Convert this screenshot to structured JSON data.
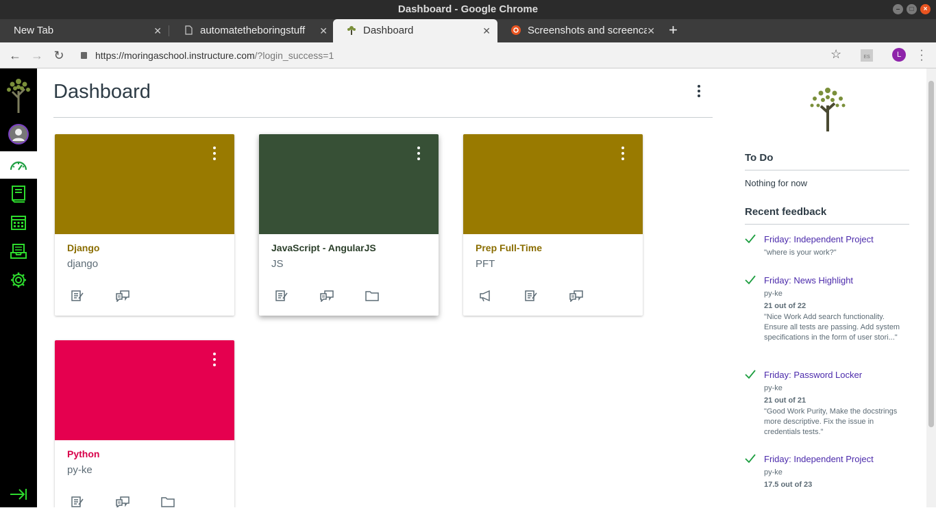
{
  "window": {
    "title": "Dashboard - Google Chrome"
  },
  "tabs": [
    {
      "label": "New Tab"
    },
    {
      "label": "automatetheboringstuff"
    },
    {
      "label": "Dashboard"
    },
    {
      "label": "Screenshots and screenca"
    }
  ],
  "address": {
    "host": "https://moringaschool.instructure.com",
    "path": "/?login_success=1"
  },
  "profile": {
    "initial": "L",
    "ext_label": "ES"
  },
  "colors": {
    "accent_green": "#2ddb2d",
    "django": "#997a00",
    "angular": "#375036",
    "prep": "#997a00",
    "python": "#e5004f",
    "link": "#4b2aab"
  },
  "dashboard": {
    "title": "Dashboard"
  },
  "cards": [
    {
      "title": "Django",
      "subtitle": "django",
      "color": "#997a00",
      "title_color": "#8a6d00",
      "icons": [
        "assignments-icon",
        "discussions-icon"
      ]
    },
    {
      "title": "JavaScript - AngularJS",
      "subtitle": "JS",
      "color": "#375036",
      "title_color": "#2b3f2a",
      "icons": [
        "assignments-icon",
        "discussions-icon",
        "files-icon"
      ]
    },
    {
      "title": "Prep Full-Time",
      "subtitle": "PFT",
      "color": "#997a00",
      "title_color": "#8a6d00",
      "icons": [
        "announcements-icon",
        "assignments-icon",
        "discussions-icon"
      ]
    },
    {
      "title": "Python",
      "subtitle": "py-ke",
      "color": "#e5004f",
      "title_color": "#d8004a",
      "icons": [
        "assignments-icon",
        "discussions-icon",
        "files-icon"
      ]
    }
  ],
  "todo": {
    "heading": "To Do",
    "empty": "Nothing for now"
  },
  "feedback": {
    "heading": "Recent feedback",
    "items": [
      {
        "title": "Friday: Independent Project",
        "course": "",
        "score": "",
        "comment": "\"where is your work?\""
      },
      {
        "title": "Friday: News Highlight",
        "course": "py-ke",
        "score": "21 out of 22",
        "comment": "\"Nice Work Add search functionality. Ensure all tests are passing. Add system specifications in the form of user stori...\""
      },
      {
        "title": "Friday: Password Locker",
        "course": "py-ke",
        "score": "21 out of 21",
        "comment": "\"Good Work Purity, Make the docstrings more descriptive. Fix the issue in credentials tests.\""
      },
      {
        "title": "Friday: Independent Project",
        "course": "py-ke",
        "score": "17.5 out of 23",
        "comment": ""
      }
    ]
  }
}
